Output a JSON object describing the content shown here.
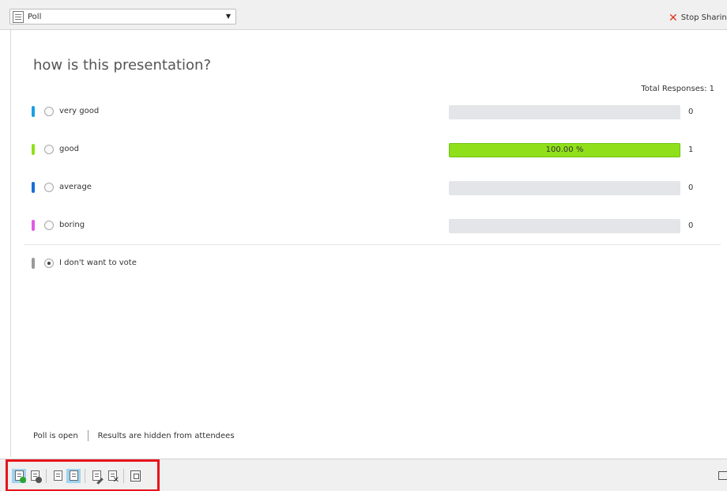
{
  "header": {
    "pod_selector_label": "Poll",
    "pod_selector_icon": "poll-icon",
    "stop_sharing_label": "Stop Sharing",
    "stop_sharing_icon": "close-x-icon",
    "stop_sharing_color": "#e0321e"
  },
  "poll": {
    "question": "how is this presentation?",
    "total_responses": "Total Responses: 1",
    "answers": [
      {
        "label": "very good",
        "color": "#1aa0e6",
        "count": "0",
        "percent": 0,
        "percent_label": ""
      },
      {
        "label": "good",
        "color": "#8fe01a",
        "count": "1",
        "percent": 100,
        "percent_label": "100.00 %"
      },
      {
        "label": "average",
        "color": "#1a6fd6",
        "count": "0",
        "percent": 0,
        "percent_label": ""
      },
      {
        "label": "boring",
        "color": "#e05ae6",
        "count": "0",
        "percent": 0,
        "percent_label": ""
      }
    ],
    "abstain": {
      "label": "I don't want to vote",
      "color": "#9a9a9a",
      "selected": true
    }
  },
  "status": {
    "state": "Poll is open",
    "visibility": "Results are hidden from attendees"
  },
  "toolbar": {
    "tools": [
      {
        "name": "open-poll",
        "icon": "open-poll-icon",
        "active": true
      },
      {
        "name": "close-poll",
        "icon": "close-poll-icon",
        "active": false
      },
      {
        "name": "hide-results",
        "icon": "hide-results-icon",
        "active": false
      },
      {
        "name": "show-results",
        "icon": "show-results-icon",
        "active": true
      },
      {
        "name": "edit-poll",
        "icon": "edit-poll-icon",
        "active": false
      },
      {
        "name": "clear-answers",
        "icon": "clear-answers-icon",
        "active": false
      },
      {
        "name": "broadcast-results",
        "icon": "broadcast-results-icon",
        "active": false
      }
    ],
    "highlight_color": "#e8141c"
  }
}
